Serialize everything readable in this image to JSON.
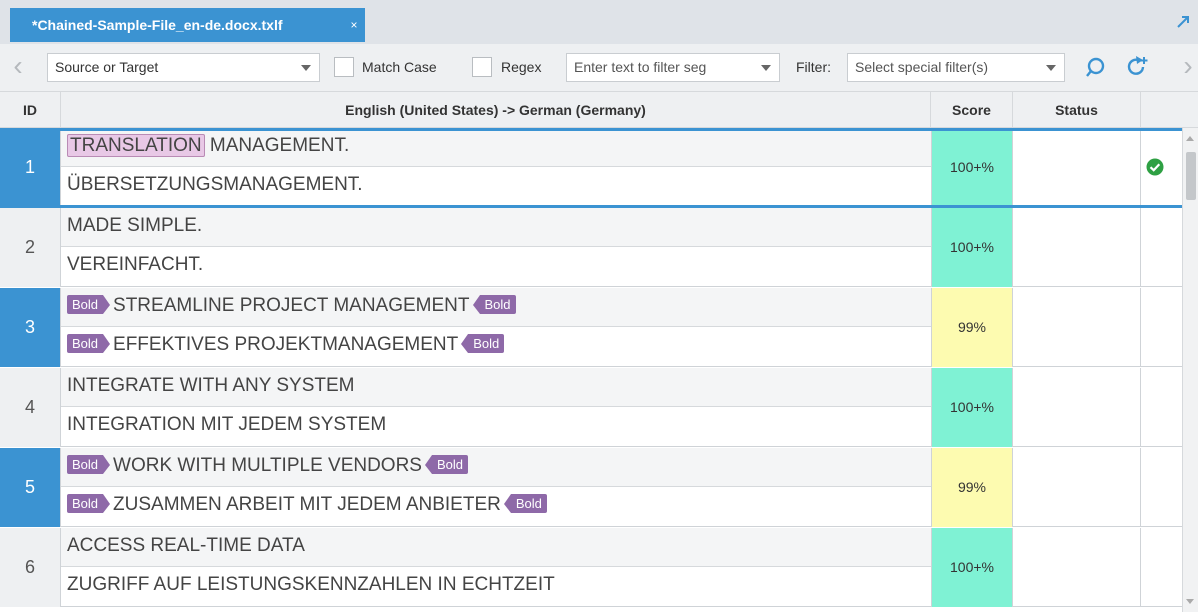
{
  "tab": {
    "title": "*Chained-Sample-File_en-de.docx.txlf",
    "close": "×"
  },
  "toolbar": {
    "scope_select": "Source or Target",
    "match_case_label": "Match Case",
    "regex_label": "Regex",
    "filter_input_placeholder": "Enter text to filter seg",
    "filter_label": "Filter:",
    "special_filter_placeholder": "Select special filter(s)"
  },
  "header": {
    "id": "ID",
    "language_pair": "English (United States) -> German (Germany)",
    "score": "Score",
    "status": "Status"
  },
  "tag_label": "Bold",
  "colors": {
    "accent": "#3b93d2",
    "score_exact": "#7ff2d4",
    "score_fuzzy": "#fdfbb0",
    "tag": "#8e69a8",
    "confirmed": "#2ea043"
  },
  "rows": [
    {
      "id": "1",
      "source_highlight": "TRANSLATION",
      "source_rest": " MANAGEMENT.",
      "target": "ÜBERSETZUNGSMANAGEMENT.",
      "score": "100+%",
      "status_icon": "check-circle-icon"
    },
    {
      "id": "2",
      "source": "MADE SIMPLE.",
      "target": "VEREINFACHT.",
      "score": "100+%"
    },
    {
      "id": "3",
      "source": "STREAMLINE PROJECT MANAGEMENT",
      "target": "EFFEKTIVES PROJEKTMANAGEMENT",
      "score": "99%"
    },
    {
      "id": "4",
      "source": "INTEGRATE WITH ANY SYSTEM",
      "target": "INTEGRATION MIT JEDEM SYSTEM",
      "score": "100+%"
    },
    {
      "id": "5",
      "source": "WORK WITH MULTIPLE VENDORS",
      "target": "ZUSAMMEN ARBEIT MIT JEDEM ANBIETER",
      "score": "99%"
    },
    {
      "id": "6",
      "source": "ACCESS REAL-TIME DATA",
      "target": "ZUGRIFF AUF LEISTUNGSKENNZAHLEN IN ECHTZEIT",
      "score": "100+%"
    }
  ]
}
